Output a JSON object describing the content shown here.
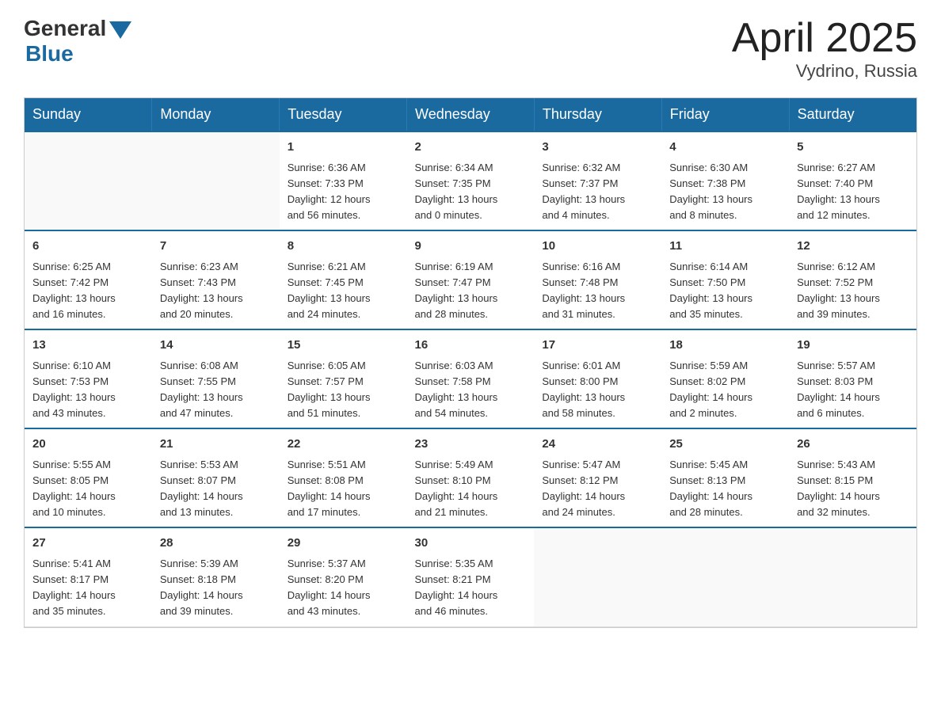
{
  "logo": {
    "general": "General",
    "blue": "Blue"
  },
  "title": {
    "month_year": "April 2025",
    "location": "Vydrino, Russia"
  },
  "calendar": {
    "headers": [
      "Sunday",
      "Monday",
      "Tuesday",
      "Wednesday",
      "Thursday",
      "Friday",
      "Saturday"
    ],
    "weeks": [
      [
        {
          "day": "",
          "info": ""
        },
        {
          "day": "",
          "info": ""
        },
        {
          "day": "1",
          "info": "Sunrise: 6:36 AM\nSunset: 7:33 PM\nDaylight: 12 hours\nand 56 minutes."
        },
        {
          "day": "2",
          "info": "Sunrise: 6:34 AM\nSunset: 7:35 PM\nDaylight: 13 hours\nand 0 minutes."
        },
        {
          "day": "3",
          "info": "Sunrise: 6:32 AM\nSunset: 7:37 PM\nDaylight: 13 hours\nand 4 minutes."
        },
        {
          "day": "4",
          "info": "Sunrise: 6:30 AM\nSunset: 7:38 PM\nDaylight: 13 hours\nand 8 minutes."
        },
        {
          "day": "5",
          "info": "Sunrise: 6:27 AM\nSunset: 7:40 PM\nDaylight: 13 hours\nand 12 minutes."
        }
      ],
      [
        {
          "day": "6",
          "info": "Sunrise: 6:25 AM\nSunset: 7:42 PM\nDaylight: 13 hours\nand 16 minutes."
        },
        {
          "day": "7",
          "info": "Sunrise: 6:23 AM\nSunset: 7:43 PM\nDaylight: 13 hours\nand 20 minutes."
        },
        {
          "day": "8",
          "info": "Sunrise: 6:21 AM\nSunset: 7:45 PM\nDaylight: 13 hours\nand 24 minutes."
        },
        {
          "day": "9",
          "info": "Sunrise: 6:19 AM\nSunset: 7:47 PM\nDaylight: 13 hours\nand 28 minutes."
        },
        {
          "day": "10",
          "info": "Sunrise: 6:16 AM\nSunset: 7:48 PM\nDaylight: 13 hours\nand 31 minutes."
        },
        {
          "day": "11",
          "info": "Sunrise: 6:14 AM\nSunset: 7:50 PM\nDaylight: 13 hours\nand 35 minutes."
        },
        {
          "day": "12",
          "info": "Sunrise: 6:12 AM\nSunset: 7:52 PM\nDaylight: 13 hours\nand 39 minutes."
        }
      ],
      [
        {
          "day": "13",
          "info": "Sunrise: 6:10 AM\nSunset: 7:53 PM\nDaylight: 13 hours\nand 43 minutes."
        },
        {
          "day": "14",
          "info": "Sunrise: 6:08 AM\nSunset: 7:55 PM\nDaylight: 13 hours\nand 47 minutes."
        },
        {
          "day": "15",
          "info": "Sunrise: 6:05 AM\nSunset: 7:57 PM\nDaylight: 13 hours\nand 51 minutes."
        },
        {
          "day": "16",
          "info": "Sunrise: 6:03 AM\nSunset: 7:58 PM\nDaylight: 13 hours\nand 54 minutes."
        },
        {
          "day": "17",
          "info": "Sunrise: 6:01 AM\nSunset: 8:00 PM\nDaylight: 13 hours\nand 58 minutes."
        },
        {
          "day": "18",
          "info": "Sunrise: 5:59 AM\nSunset: 8:02 PM\nDaylight: 14 hours\nand 2 minutes."
        },
        {
          "day": "19",
          "info": "Sunrise: 5:57 AM\nSunset: 8:03 PM\nDaylight: 14 hours\nand 6 minutes."
        }
      ],
      [
        {
          "day": "20",
          "info": "Sunrise: 5:55 AM\nSunset: 8:05 PM\nDaylight: 14 hours\nand 10 minutes."
        },
        {
          "day": "21",
          "info": "Sunrise: 5:53 AM\nSunset: 8:07 PM\nDaylight: 14 hours\nand 13 minutes."
        },
        {
          "day": "22",
          "info": "Sunrise: 5:51 AM\nSunset: 8:08 PM\nDaylight: 14 hours\nand 17 minutes."
        },
        {
          "day": "23",
          "info": "Sunrise: 5:49 AM\nSunset: 8:10 PM\nDaylight: 14 hours\nand 21 minutes."
        },
        {
          "day": "24",
          "info": "Sunrise: 5:47 AM\nSunset: 8:12 PM\nDaylight: 14 hours\nand 24 minutes."
        },
        {
          "day": "25",
          "info": "Sunrise: 5:45 AM\nSunset: 8:13 PM\nDaylight: 14 hours\nand 28 minutes."
        },
        {
          "day": "26",
          "info": "Sunrise: 5:43 AM\nSunset: 8:15 PM\nDaylight: 14 hours\nand 32 minutes."
        }
      ],
      [
        {
          "day": "27",
          "info": "Sunrise: 5:41 AM\nSunset: 8:17 PM\nDaylight: 14 hours\nand 35 minutes."
        },
        {
          "day": "28",
          "info": "Sunrise: 5:39 AM\nSunset: 8:18 PM\nDaylight: 14 hours\nand 39 minutes."
        },
        {
          "day": "29",
          "info": "Sunrise: 5:37 AM\nSunset: 8:20 PM\nDaylight: 14 hours\nand 43 minutes."
        },
        {
          "day": "30",
          "info": "Sunrise: 5:35 AM\nSunset: 8:21 PM\nDaylight: 14 hours\nand 46 minutes."
        },
        {
          "day": "",
          "info": ""
        },
        {
          "day": "",
          "info": ""
        },
        {
          "day": "",
          "info": ""
        }
      ]
    ]
  }
}
